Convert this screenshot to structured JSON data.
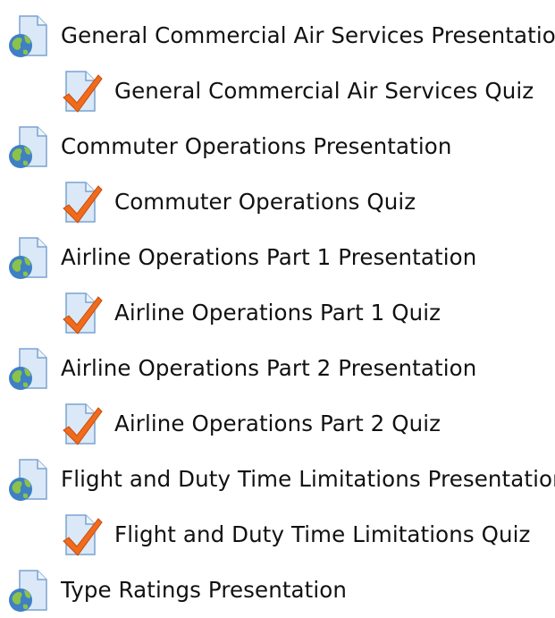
{
  "activities": [
    {
      "type": "presentation",
      "icon": "web-page-globe-icon",
      "label": "General Commercial Air Services Presentation"
    },
    {
      "type": "quiz",
      "icon": "quiz-checkmark-icon",
      "label": "General Commercial Air Services Quiz"
    },
    {
      "type": "presentation",
      "icon": "web-page-globe-icon",
      "label": "Commuter Operations Presentation"
    },
    {
      "type": "quiz",
      "icon": "quiz-checkmark-icon",
      "label": "Commuter Operations Quiz"
    },
    {
      "type": "presentation",
      "icon": "web-page-globe-icon",
      "label": "Airline Operations Part 1 Presentation"
    },
    {
      "type": "quiz",
      "icon": "quiz-checkmark-icon",
      "label": "Airline Operations Part 1 Quiz"
    },
    {
      "type": "presentation",
      "icon": "web-page-globe-icon",
      "label": "Airline Operations Part 2 Presentation"
    },
    {
      "type": "quiz",
      "icon": "quiz-checkmark-icon",
      "label": "Airline Operations Part 2 Quiz"
    },
    {
      "type": "presentation",
      "icon": "web-page-globe-icon",
      "label": "Flight and Duty Time Limitations Presentation"
    },
    {
      "type": "quiz",
      "icon": "quiz-checkmark-icon",
      "label": "Flight and Duty Time Limitations Quiz"
    },
    {
      "type": "presentation",
      "icon": "web-page-globe-icon",
      "label": "Type Ratings Presentation"
    }
  ],
  "colors": {
    "page_fill": "#dbe8f7",
    "page_stroke": "#7aa3d0",
    "globe_blue": "#3f7fc4",
    "globe_green": "#8bc34a",
    "check_orange": "#f26a1b"
  }
}
